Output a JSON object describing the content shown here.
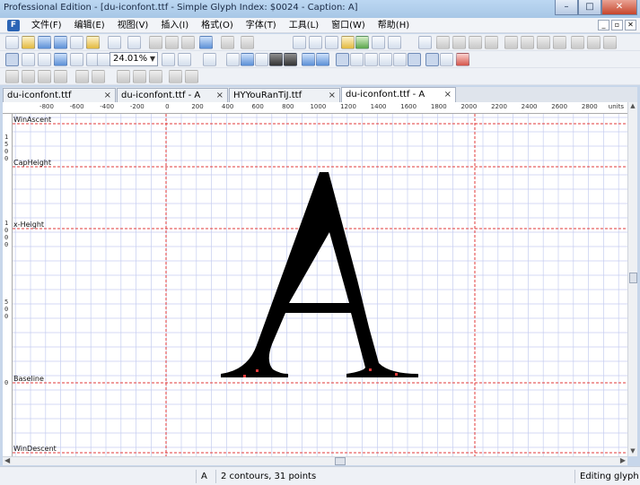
{
  "window": {
    "title": "Professional Edition - [du-iconfont.ttf - Simple Glyph Index: $0024 - Caption: A]",
    "minimize": "–",
    "maximize": "□",
    "close": "✕"
  },
  "menu": {
    "items": [
      "文件(F)",
      "编辑(E)",
      "视图(V)",
      "插入(I)",
      "格式(O)",
      "字体(T)",
      "工具(L)",
      "窗口(W)",
      "帮助(H)"
    ],
    "mdi_min": "_",
    "mdi_restore": "▫",
    "mdi_close": "✕"
  },
  "toolbar": {
    "zoom_value": "24.01%"
  },
  "tabs": [
    {
      "label": "du-iconfont.ttf",
      "close": "×"
    },
    {
      "label": "du-iconfont.ttf - A",
      "close": "×"
    },
    {
      "label": "HYYouRanTiJ.ttf",
      "close": "×"
    },
    {
      "label": "du-iconfont.ttf - A",
      "close": "×"
    }
  ],
  "ruler": {
    "units": "units",
    "labels": [
      "-800",
      "-600",
      "-400",
      "-200",
      "0",
      "200",
      "400",
      "600",
      "800",
      "1000",
      "1200",
      "1400",
      "1600",
      "1800",
      "2000",
      "2200",
      "2400",
      "2600",
      "2800"
    ]
  },
  "metrics": {
    "win_ascent": "WinAscent",
    "cap_height": "CapHeight",
    "x_height": "x-Height",
    "baseline": "Baseline",
    "win_descent": "WinDescent"
  },
  "status": {
    "glyph": "A",
    "contours": "2 contours, 31 points",
    "mode": "Editing glyph"
  },
  "colors": {
    "grid": "#c6cdf0",
    "guide": "#e23a3a",
    "glyph": "#000000"
  }
}
